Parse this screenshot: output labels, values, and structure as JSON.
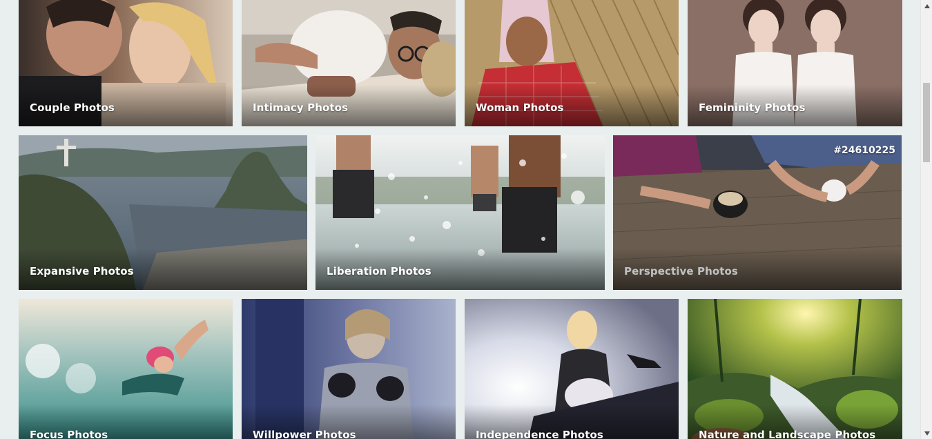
{
  "gallery": {
    "row1": [
      {
        "label": "Couple Photos"
      },
      {
        "label": "Intimacy Photos"
      },
      {
        "label": "Woman Photos"
      },
      {
        "label": "Femininity Photos"
      }
    ],
    "row2": [
      {
        "label": "Expansive Photos"
      },
      {
        "label": "Liberation Photos"
      },
      {
        "label": "Perspective Photos",
        "tag": "#24610225"
      }
    ],
    "row3": [
      {
        "label": "Focus Photos"
      },
      {
        "label": "Willpower Photos"
      },
      {
        "label": "Independence Photos"
      },
      {
        "label": "Nature and Landscape Photos"
      }
    ]
  },
  "colors": {
    "page_background": "#e9eeee",
    "label_text": "#ffffff"
  },
  "scrollbar": {
    "up_icon": "triangle-up-icon",
    "down_icon": "triangle-down-icon"
  }
}
